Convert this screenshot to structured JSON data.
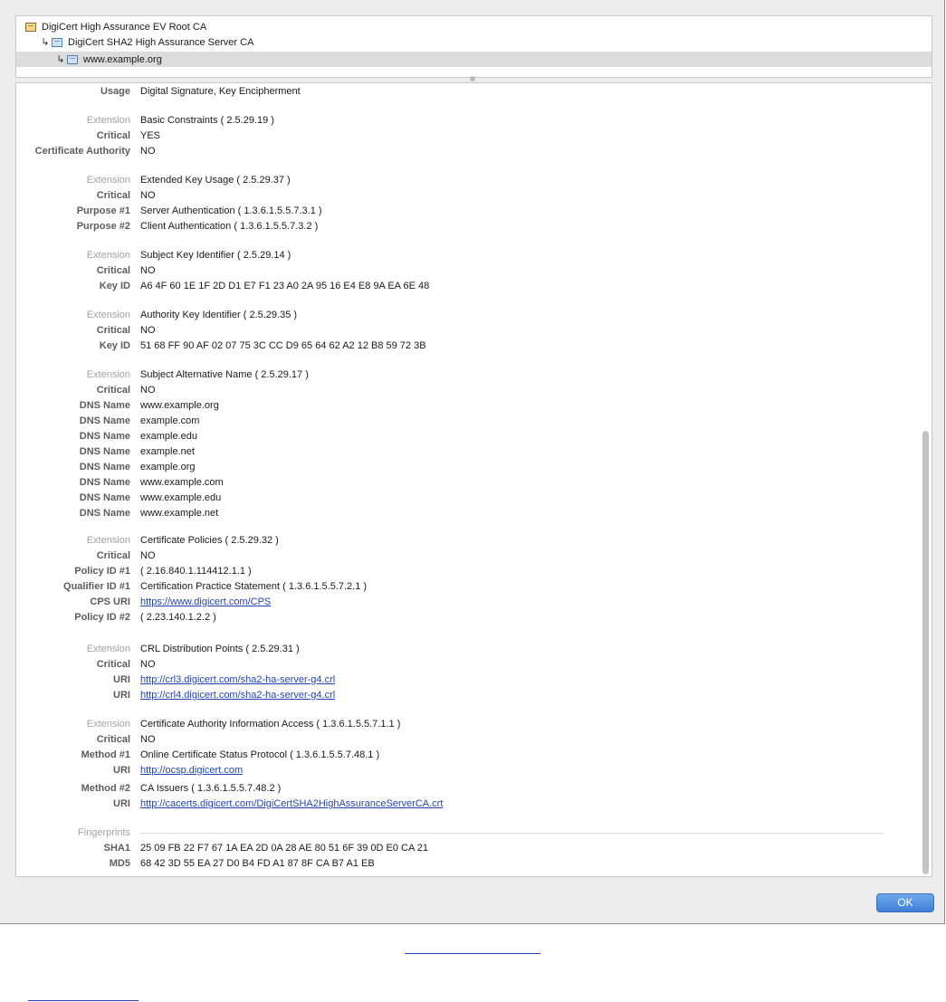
{
  "tree": [
    {
      "label": "DigiCert High Assurance EV Root CA",
      "icon": "root-cert-icon",
      "indent": 0,
      "selected": false
    },
    {
      "label": "DigiCert SHA2 High Assurance Server CA",
      "icon": "intermediate-cert-icon",
      "indent": 1,
      "selected": false
    },
    {
      "label": "www.example.org",
      "icon": "leaf-cert-icon",
      "indent": 2,
      "selected": true
    }
  ],
  "tree_arrow": "↳",
  "rows": [
    {
      "label": "Usage",
      "value": "Digital Signature, Key Encipherment"
    },
    {
      "label": "Extension",
      "value": "Basic Constraints ( 2.5.29.19 )",
      "ext": true
    },
    {
      "label": "Critical",
      "value": "YES"
    },
    {
      "label": "Certificate Authority",
      "value": "NO"
    },
    {
      "label": "Extension",
      "value": "Extended Key Usage ( 2.5.29.37 )",
      "ext": true
    },
    {
      "label": "Critical",
      "value": "NO"
    },
    {
      "label": "Purpose #1",
      "value": "Server Authentication ( 1.3.6.1.5.5.7.3.1 )"
    },
    {
      "label": "Purpose #2",
      "value": "Client Authentication ( 1.3.6.1.5.5.7.3.2 )"
    },
    {
      "label": "Extension",
      "value": "Subject Key Identifier ( 2.5.29.14 )",
      "ext": true
    },
    {
      "label": "Critical",
      "value": "NO"
    },
    {
      "label": "Key ID",
      "value": "A6 4F 60 1E 1F 2D D1 E7 F1 23 A0 2A 95 16 E4 E8 9A EA 6E 48"
    },
    {
      "label": "Extension",
      "value": "Authority Key Identifier ( 2.5.29.35 )",
      "ext": true
    },
    {
      "label": "Critical",
      "value": "NO"
    },
    {
      "label": "Key ID",
      "value": "51 68 FF 90 AF 02 07 75 3C CC D9 65 64 62 A2 12 B8 59 72 3B"
    },
    {
      "label": "Extension",
      "value": "Subject Alternative Name ( 2.5.29.17 )",
      "ext": true
    },
    {
      "label": "Critical",
      "value": "NO"
    },
    {
      "label": "DNS Name",
      "value": "www.example.org"
    },
    {
      "label": "DNS Name",
      "value": "example.com"
    },
    {
      "label": "DNS Name",
      "value": "example.edu"
    },
    {
      "label": "DNS Name",
      "value": "example.net"
    },
    {
      "label": "DNS Name",
      "value": "example.org"
    },
    {
      "label": "DNS Name",
      "value": "www.example.com"
    },
    {
      "label": "DNS Name",
      "value": "www.example.edu"
    },
    {
      "label": "DNS Name",
      "value": "www.example.net"
    },
    {
      "label": "Extension",
      "value": "Certificate Policies ( 2.5.29.32 )",
      "ext": true
    },
    {
      "label": "Critical",
      "value": "NO"
    },
    {
      "label": "Policy ID #1",
      "value": "( 2.16.840.1.114412.1.1 )"
    },
    {
      "label": "Qualifier ID #1",
      "value": "Certification Practice Statement ( 1.3.6.1.5.5.7.2.1 )"
    },
    {
      "label": "CPS URI",
      "value": "https://www.digicert.com/CPS",
      "link": true
    },
    {
      "label": "Policy ID #2",
      "value": "( 2.23.140.1.2.2 )"
    },
    {
      "label": "Extension",
      "value": "CRL Distribution Points ( 2.5.29.31 )",
      "ext": true
    },
    {
      "label": "Critical",
      "value": "NO"
    },
    {
      "label": "URI",
      "value": "http://crl3.digicert.com/sha2-ha-server-g4.crl",
      "link": true
    },
    {
      "label": "URI",
      "value": "http://crl4.digicert.com/sha2-ha-server-g4.crl",
      "link": true
    },
    {
      "label": "Extension",
      "value": "Certificate Authority Information Access ( 1.3.6.1.5.5.7.1.1 )",
      "ext": true
    },
    {
      "label": "Critical",
      "value": "NO"
    },
    {
      "label": "Method #1",
      "value": "Online Certificate Status Protocol ( 1.3.6.1.5.5.7.48.1 )"
    },
    {
      "label": "URI",
      "value": "http://ocsp.digicert.com",
      "link": true
    },
    {
      "label": "Method #2",
      "value": "CA Issuers ( 1.3.6.1.5.5.7.48.2 )"
    },
    {
      "label": "URI",
      "value": "http://cacerts.digicert.com/DigiCertSHA2HighAssuranceServerCA.crt",
      "link": true
    },
    {
      "label": "Fingerprints",
      "value": "",
      "ext": true
    },
    {
      "label": "SHA1",
      "value": "25 09 FB 22 F7 67 1A EA 2D 0A 28 AE 80 51 6F 39 0D E0 CA 21"
    },
    {
      "label": "MD5",
      "value": "68 42 3D 55 EA 27 D0 B4 FD A1 87 8F CA B7 A1 EB"
    }
  ],
  "ok_label": "OK",
  "colors": {
    "link": "#2443b0",
    "ok_button": "#4a88e0",
    "selected_row": "#dcdcdc"
  }
}
